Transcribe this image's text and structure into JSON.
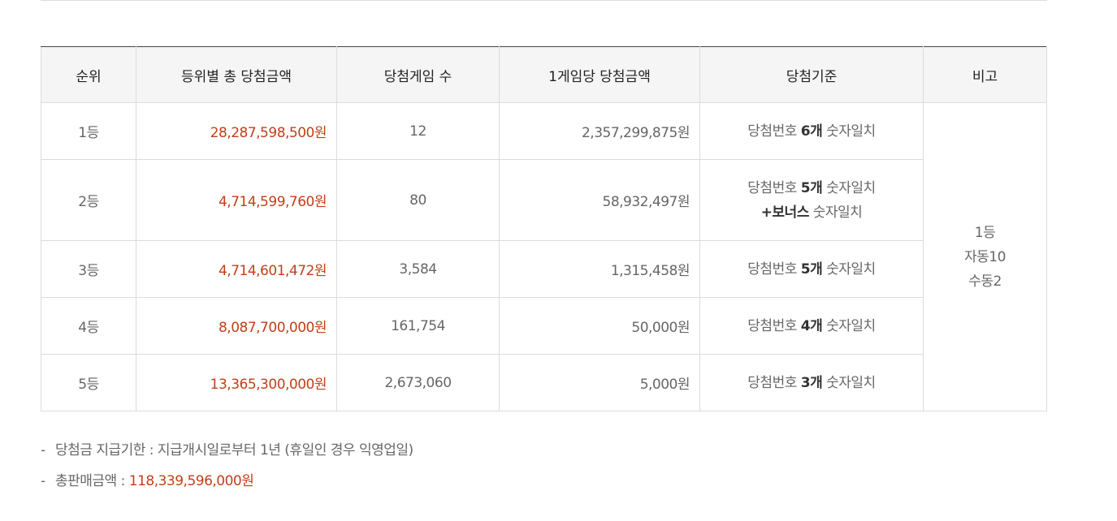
{
  "table": {
    "headers": [
      "순위",
      "등위별 총 당첨금액",
      "당첨게임 수",
      "1게임당 당첨금액",
      "당첨기준",
      "비고"
    ],
    "rows": [
      {
        "rank": "1등",
        "total": "28,287,598,500원",
        "games": "12",
        "per_game": "2,357,299,875원",
        "crit_prefix": "당첨번호 ",
        "crit_count": "6개",
        "crit_suffix": " 숫자일치",
        "crit_extra_bold": "",
        "crit_extra": ""
      },
      {
        "rank": "2등",
        "total": "4,714,599,760원",
        "games": "80",
        "per_game": "58,932,497원",
        "crit_prefix": "당첨번호 ",
        "crit_count": "5개",
        "crit_suffix": " 숫자일치",
        "crit_extra_bold": "+보너스",
        "crit_extra": " 숫자일치"
      },
      {
        "rank": "3등",
        "total": "4,714,601,472원",
        "games": "3,584",
        "per_game": "1,315,458원",
        "crit_prefix": "당첨번호 ",
        "crit_count": "5개",
        "crit_suffix": " 숫자일치",
        "crit_extra_bold": "",
        "crit_extra": ""
      },
      {
        "rank": "4등",
        "total": "8,087,700,000원",
        "games": "161,754",
        "per_game": "50,000원",
        "crit_prefix": "당첨번호 ",
        "crit_count": "4개",
        "crit_suffix": " 숫자일치",
        "crit_extra_bold": "",
        "crit_extra": ""
      },
      {
        "rank": "5등",
        "total": "13,365,300,000원",
        "games": "2,673,060",
        "per_game": "5,000원",
        "crit_prefix": "당첨번호 ",
        "crit_count": "3개",
        "crit_suffix": " 숫자일치",
        "crit_extra_bold": "",
        "crit_extra": ""
      }
    ],
    "remark_lines": [
      "1등",
      "자동10",
      "수동2"
    ]
  },
  "notes": {
    "dash": "-",
    "deadline": "당첨금 지급기한 : 지급개시일로부터 1년 (휴일인 경우 익영업일)",
    "sales_label": "총판매금액 : ",
    "sales_value": "118,339,596,000원"
  },
  "colors": {
    "accent_red": "#c0401a",
    "header_bg": "#f5f5f5",
    "border": "#dcdcdc"
  }
}
